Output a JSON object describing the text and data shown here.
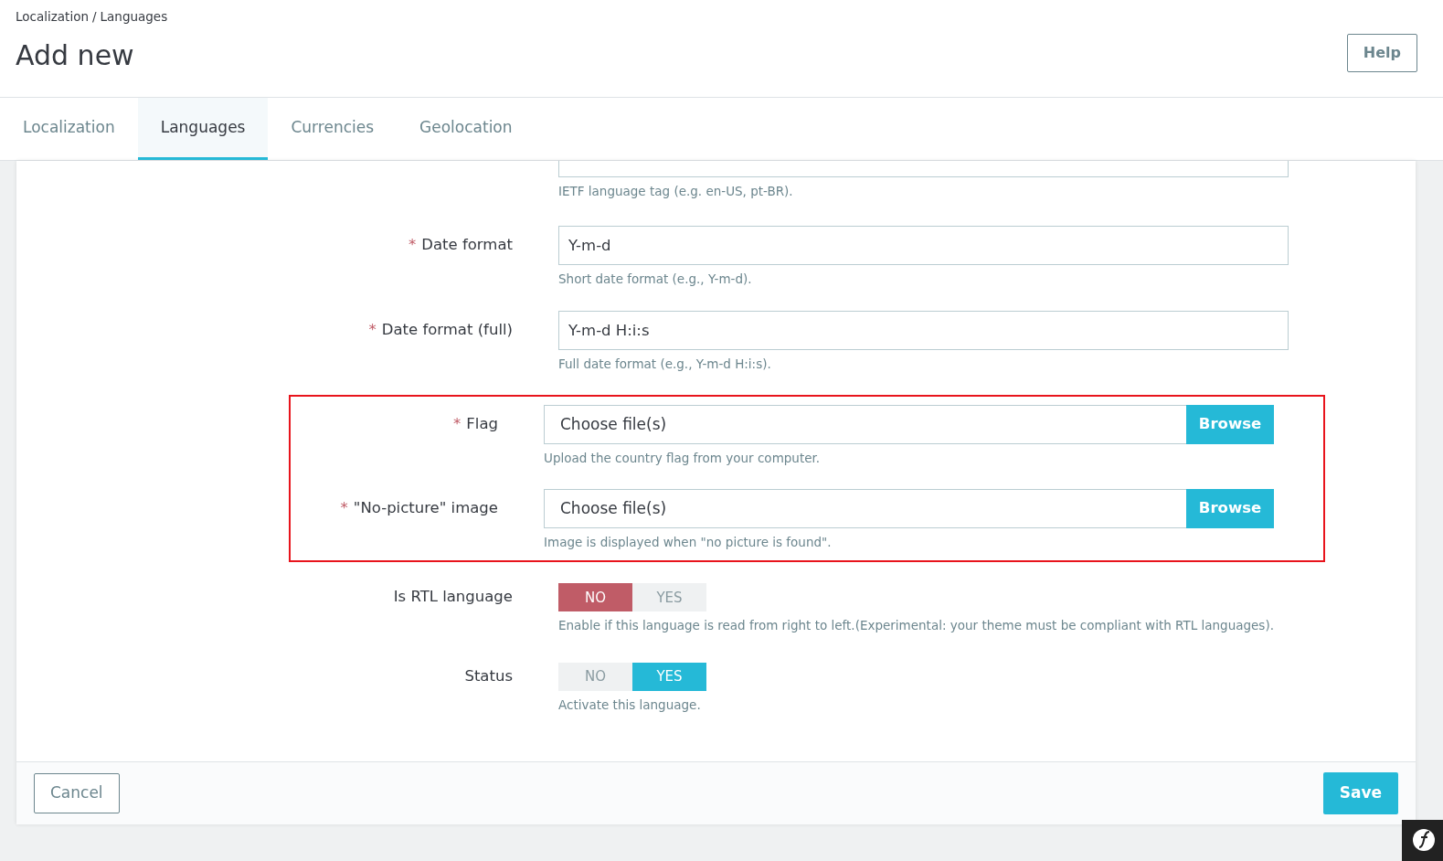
{
  "breadcrumb": {
    "items": [
      "Localization",
      "Languages"
    ],
    "separator": "/"
  },
  "title": "Add new",
  "help_button": "Help",
  "tabs": [
    {
      "label": "Localization",
      "selected": false
    },
    {
      "label": "Languages",
      "selected": true
    },
    {
      "label": "Currencies",
      "selected": false
    },
    {
      "label": "Geolocation",
      "selected": false
    }
  ],
  "fields": [
    {
      "kind": "partial",
      "help": "IETF language tag (e.g. en-US, pt-BR).",
      "highlighted": false
    },
    {
      "kind": "text",
      "label": "Date format",
      "required": true,
      "value": "Y-m-d",
      "help": "Short date format (e.g., Y-m-d).",
      "highlighted": false
    },
    {
      "kind": "text",
      "label": "Date format (full)",
      "required": true,
      "value": "Y-m-d H:i:s",
      "help": "Full date format (e.g., Y-m-d H:i:s).",
      "highlighted": false
    },
    {
      "kind": "file",
      "label": "Flag",
      "required": true,
      "placeholder": "Choose file(s)",
      "button": "Browse",
      "help": "Upload the country flag from your computer.",
      "highlighted": true
    },
    {
      "kind": "file",
      "label": "\"No-picture\" image",
      "required": true,
      "placeholder": "Choose file(s)",
      "button": "Browse",
      "help": "Image is displayed when \"no picture is found\".",
      "highlighted": true
    },
    {
      "kind": "switch",
      "label": "Is RTL language",
      "required": false,
      "options": [
        {
          "label": "NO",
          "kind": "off",
          "selected": true
        },
        {
          "label": "YES",
          "kind": "on",
          "selected": false
        }
      ],
      "help": "Enable if this language is read from right to left.(Experimental: your theme must be compliant with RTL languages).",
      "highlighted": false
    },
    {
      "kind": "switch",
      "label": "Status",
      "required": false,
      "options": [
        {
          "label": "NO",
          "kind": "off",
          "selected": false
        },
        {
          "label": "YES",
          "kind": "on",
          "selected": true
        }
      ],
      "help": "Activate this language.",
      "highlighted": false
    }
  ],
  "required_mark": "*",
  "footer": {
    "cancel": "Cancel",
    "save": "Save"
  }
}
